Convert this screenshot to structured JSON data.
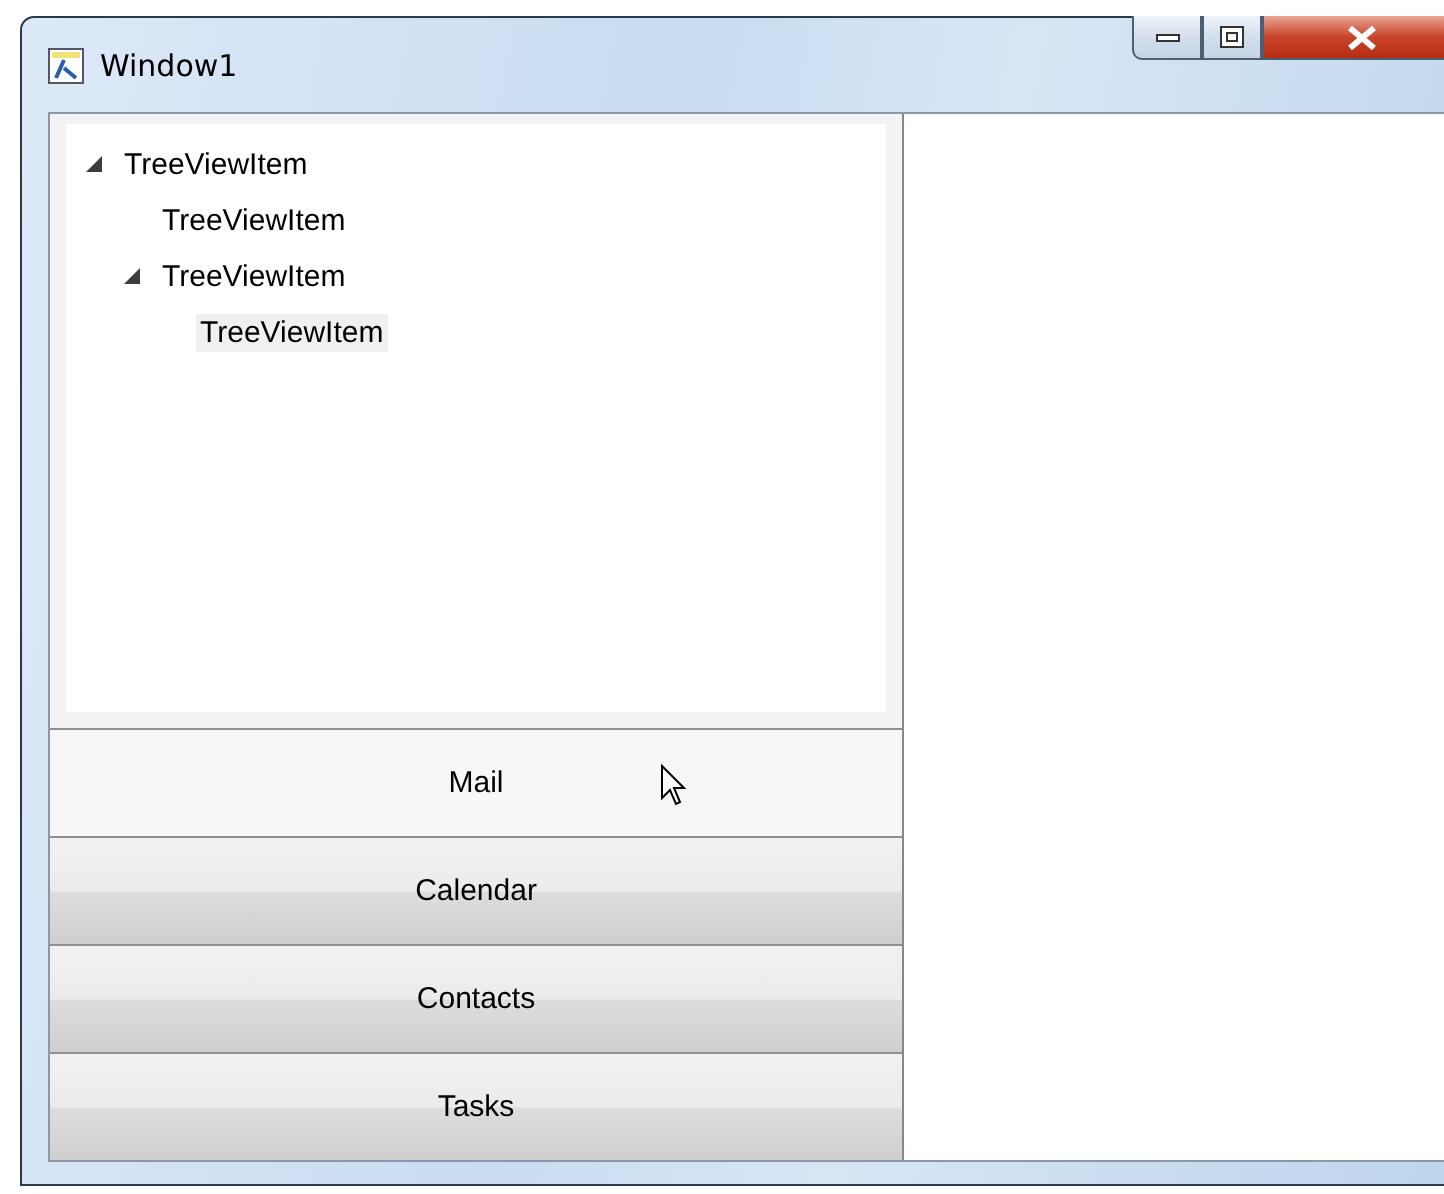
{
  "window": {
    "title": "Window1"
  },
  "tree": [
    {
      "label": "TreeViewItem",
      "expanded": true,
      "selected": false,
      "children": [
        {
          "label": "TreeViewItem",
          "selected": false
        },
        {
          "label": "TreeViewItem",
          "expanded": true,
          "selected": false,
          "children": [
            {
              "label": "TreeViewItem",
              "selected": true
            }
          ]
        }
      ]
    }
  ],
  "nav_buttons": [
    {
      "label": "Mail",
      "hovered": true
    },
    {
      "label": "Calendar",
      "hovered": false
    },
    {
      "label": "Contacts",
      "hovered": false
    },
    {
      "label": "Tasks",
      "hovered": false
    }
  ]
}
